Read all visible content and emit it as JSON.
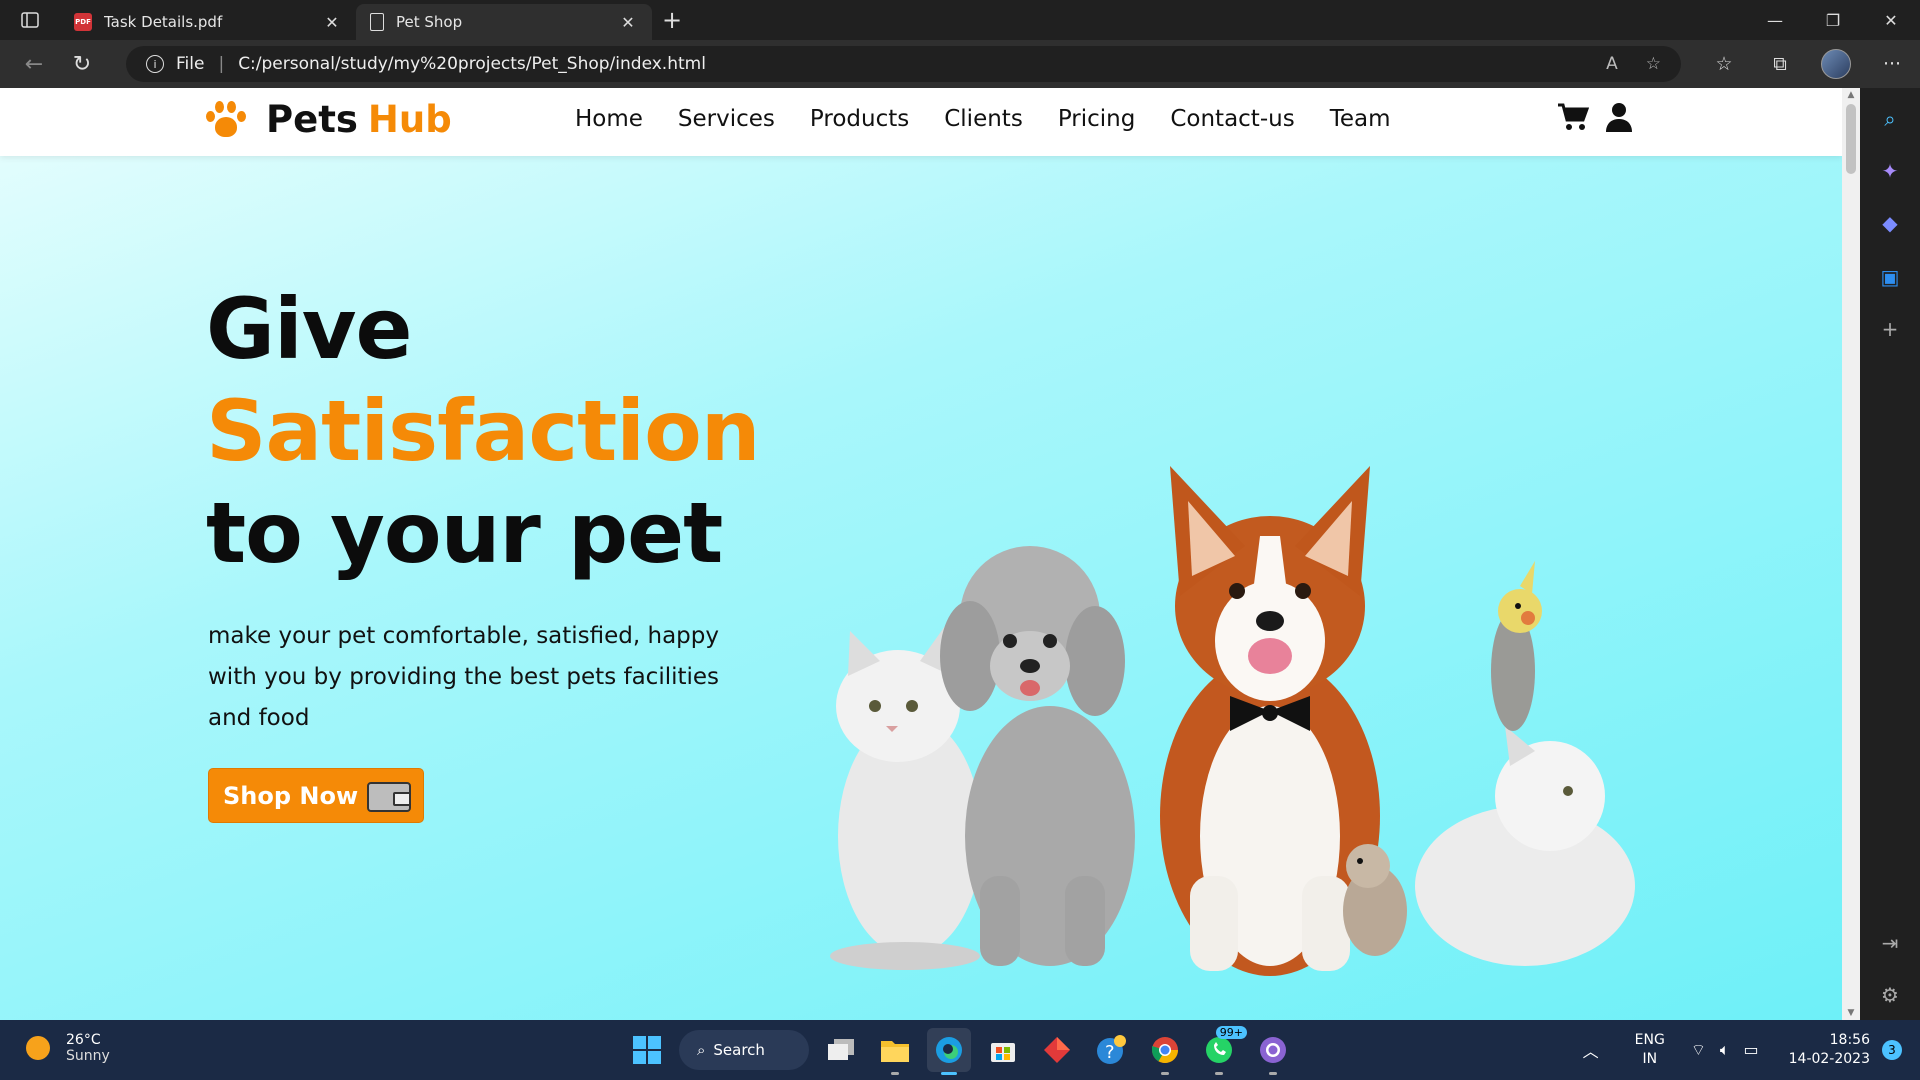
{
  "browser": {
    "tabs": [
      {
        "title": "Task Details.pdf",
        "icon": "pdf-icon",
        "active": false
      },
      {
        "title": "Pet Shop",
        "icon": "page-icon",
        "active": true
      }
    ],
    "new_tab": "+",
    "address": {
      "scheme_label": "File",
      "url": "C:/personal/study/my%20projects/Pet_Shop/index.html"
    }
  },
  "site": {
    "brand": {
      "part1": "Pets",
      "part2": "Hub"
    },
    "menu": [
      "Home",
      "Services",
      "Products",
      "Clients",
      "Pricing",
      "Contact-us",
      "Team"
    ],
    "hero": {
      "line1": "Give",
      "line2": "Satisfaction",
      "line3": "to your pet",
      "description": "make your pet comfortable, satisfied, happy with you by providing the best pets facilities and food",
      "cta": "Shop Now"
    },
    "colors": {
      "accent": "#f58a07",
      "hero_bg_start": "#e2fdfd",
      "hero_bg_end": "#6ef0f8"
    }
  },
  "taskbar": {
    "weather": {
      "temp": "26°C",
      "condition": "Sunny"
    },
    "search_label": "Search",
    "whatsapp_badge": "99+",
    "language": {
      "line1": "ENG",
      "line2": "IN"
    },
    "clock": {
      "time": "18:56",
      "date": "14-02-2023"
    },
    "notification_count": "3"
  }
}
